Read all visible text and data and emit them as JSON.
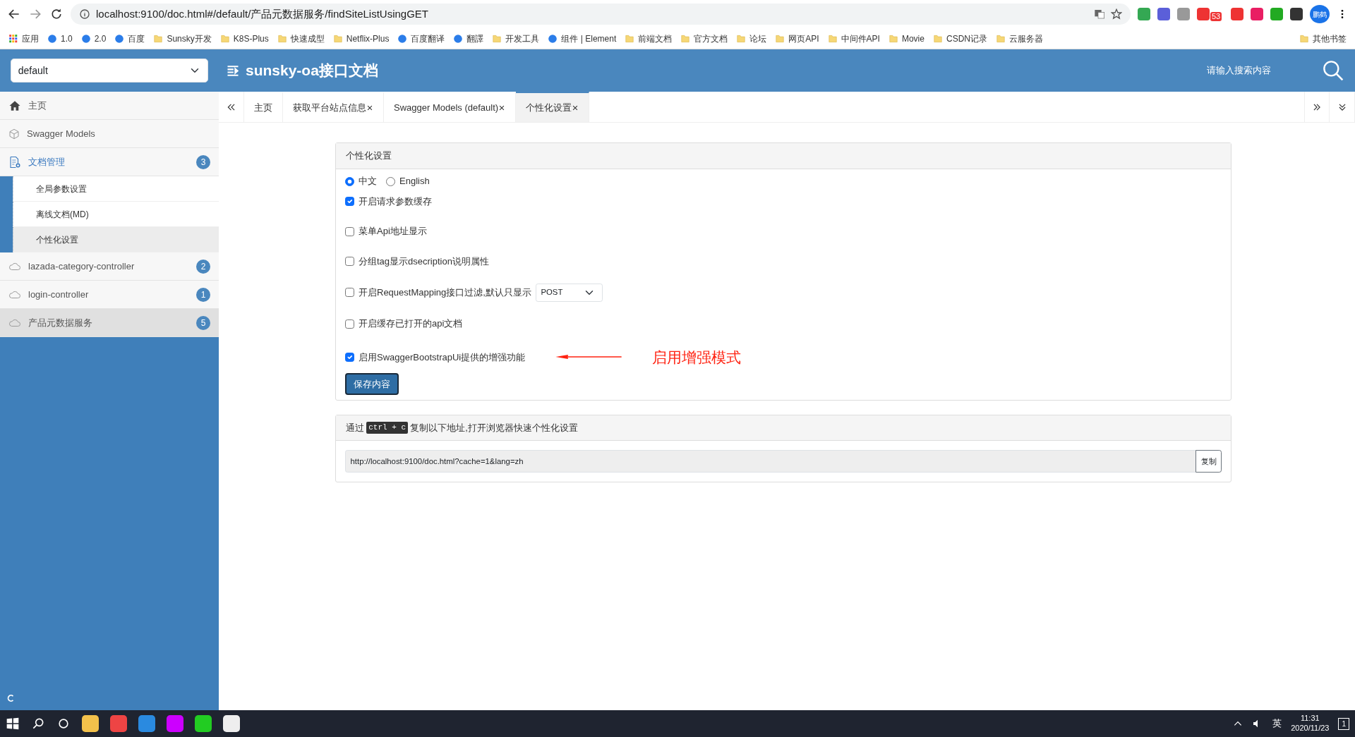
{
  "browser": {
    "url": "localhost:9100/doc.html#/default/产品元数据服务/findSiteListUsingGET",
    "extension_badge": "53",
    "profile": "鹏鹤",
    "bookmarks": [
      {
        "label": "应用",
        "kind": "apps"
      },
      {
        "label": "1.0",
        "kind": "site"
      },
      {
        "label": "2.0",
        "kind": "site"
      },
      {
        "label": "百度",
        "kind": "site"
      },
      {
        "label": "Sunsky开发",
        "kind": "folder"
      },
      {
        "label": "K8S-Plus",
        "kind": "folder"
      },
      {
        "label": "快速成型",
        "kind": "folder"
      },
      {
        "label": "Netflix-Plus",
        "kind": "folder"
      },
      {
        "label": "百度翻译",
        "kind": "site"
      },
      {
        "label": "翻譯",
        "kind": "site"
      },
      {
        "label": "开发工具",
        "kind": "folder"
      },
      {
        "label": "组件 | Element",
        "kind": "site"
      },
      {
        "label": "前端文档",
        "kind": "folder"
      },
      {
        "label": "官方文档",
        "kind": "folder"
      },
      {
        "label": "论坛",
        "kind": "folder"
      },
      {
        "label": "网页API",
        "kind": "folder"
      },
      {
        "label": "中间件API",
        "kind": "folder"
      },
      {
        "label": "Movie",
        "kind": "folder"
      },
      {
        "label": "CSDN记录",
        "kind": "folder"
      },
      {
        "label": "云服务器",
        "kind": "folder"
      }
    ],
    "other_bookmarks": "其他书签"
  },
  "header": {
    "group": "default",
    "title": "sunsky-oa接口文档",
    "search_placeholder": "请输入搜索内容"
  },
  "sidebar": [
    {
      "label": "主页",
      "kind": "home",
      "selected": false
    },
    {
      "label": "Swagger Models",
      "kind": "models",
      "selected": false
    },
    {
      "label": "文档管理",
      "kind": "docs",
      "badge": "3",
      "expanded": true,
      "children": [
        {
          "label": "全局参数设置",
          "selected": false
        },
        {
          "label": "离线文档(MD)",
          "selected": false
        },
        {
          "label": "个性化设置",
          "selected": true
        }
      ]
    },
    {
      "label": "lazada-category-controller",
      "kind": "api",
      "badge": "2",
      "selected": false
    },
    {
      "label": "login-controller",
      "kind": "api",
      "badge": "1",
      "selected": false
    },
    {
      "label": "产品元数据服务",
      "kind": "api",
      "badge": "5",
      "selected": true
    }
  ],
  "tabs": [
    {
      "label": "主页",
      "closable": false,
      "selected": false
    },
    {
      "label": "获取平台站点信息",
      "closable": true,
      "selected": false
    },
    {
      "label": "Swagger Models (default)",
      "closable": true,
      "selected": false
    },
    {
      "label": "个性化设置",
      "closable": true,
      "selected": true
    }
  ],
  "settings": {
    "title": "个性化设置",
    "languages": [
      {
        "label": "中文",
        "selected": true
      },
      {
        "label": "English",
        "selected": false
      }
    ],
    "options": [
      {
        "label": "开启请求参数缓存",
        "checked": true
      },
      {
        "label": "菜单Api地址显示",
        "checked": false
      },
      {
        "label": "分组tag显示dsecription说明属性",
        "checked": false
      },
      {
        "label": "开启RequestMapping接口过滤,默认只显示",
        "checked": false,
        "select": "POST"
      },
      {
        "label": "开启缓存已打开的api文档",
        "checked": false
      },
      {
        "label": "启用SwaggerBootstrapUi提供的增强功能",
        "checked": true,
        "annotation": "启用增强模式"
      }
    ],
    "save": "保存内容"
  },
  "share": {
    "prefix": "通过",
    "shortcut": "ctrl + c",
    "suffix": "复制以下地址,打开浏览器快速个性化设置",
    "url": "http://localhost:9100/doc.html?cache=1&lang=zh",
    "copy": "复制"
  },
  "taskbar": {
    "ime": "英",
    "time": "11:31",
    "date": "2020/11/23",
    "notifications": "1"
  }
}
